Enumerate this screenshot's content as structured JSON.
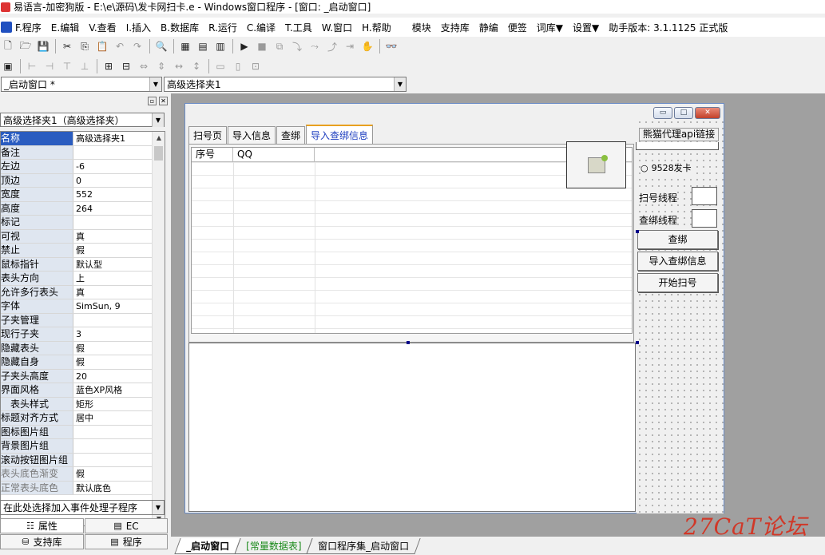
{
  "window": {
    "title": "易语言-加密狗版 - E:\\e\\源码\\发卡网扫卡.e - Windows窗口程序 - [窗口: _启动窗口]"
  },
  "menu": {
    "items": [
      "F.程序",
      "E.编辑",
      "V.查看",
      "I.插入",
      "B.数据库",
      "R.运行",
      "C.编译",
      "T.工具",
      "W.窗口",
      "H.帮助"
    ],
    "extra": [
      "模块",
      "支持库",
      "静编",
      "便签",
      "词库▼",
      "设置▼",
      "助手版本: 3.1.1125 正式版"
    ]
  },
  "combos": {
    "window_select": "_启动窗口 *",
    "control_select": "高级选择夹1"
  },
  "props": {
    "object_select": "高级选择夹1（高级选择夹）",
    "rows": [
      {
        "name": "名称",
        "value": "高级选择夹1"
      },
      {
        "name": "备注",
        "value": ""
      },
      {
        "name": "左边",
        "value": "-6"
      },
      {
        "name": "顶边",
        "value": "0"
      },
      {
        "name": "宽度",
        "value": "552"
      },
      {
        "name": "高度",
        "value": "264"
      },
      {
        "name": "标记",
        "value": ""
      },
      {
        "name": "可视",
        "value": "真"
      },
      {
        "name": "禁止",
        "value": "假"
      },
      {
        "name": "鼠标指针",
        "value": "默认型"
      },
      {
        "name": "表头方向",
        "value": "上"
      },
      {
        "name": "允许多行表头",
        "value": "真"
      },
      {
        "name": "字体",
        "value": "SimSun, 9"
      },
      {
        "name": "子夹管理",
        "value": ""
      },
      {
        "name": "现行子夹",
        "value": "3"
      },
      {
        "name": "隐藏表头",
        "value": "假"
      },
      {
        "name": "隐藏自身",
        "value": "假"
      },
      {
        "name": "子夹头高度",
        "value": "20"
      },
      {
        "name": "界面风格",
        "value": "蓝色XP风格"
      },
      {
        "name": "　表头样式",
        "value": "矩形"
      },
      {
        "name": "标题对齐方式",
        "value": "居中"
      },
      {
        "name": "图标图片组",
        "value": ""
      },
      {
        "name": "背景图片组",
        "value": ""
      },
      {
        "name": "滚动按钮图片组",
        "value": ""
      },
      {
        "name": "表头底色渐变",
        "value": "假"
      },
      {
        "name": "正常表头底色",
        "value": "默认底色"
      }
    ],
    "event_select": "在此处选择加入事件处理子程序",
    "tabs": [
      "属性",
      "EC",
      "支持库",
      "程序"
    ]
  },
  "form": {
    "tabs": [
      "扫号页",
      "导入信息",
      "查绑",
      "导入查绑信息"
    ],
    "list_columns": [
      "序号",
      "QQ"
    ],
    "label_panda": "熊猫代理api链接",
    "radio_9528": "9528发卡",
    "label_scan_threads": "扫号线程",
    "label_bind_threads": "查绑线程",
    "btn_check": "查绑",
    "btn_import": "导入查绑信息",
    "btn_start": "开始扫号"
  },
  "bottom_tabs": [
    "_启动窗口",
    "[常量数据表]",
    "窗口程序集_启动窗口"
  ],
  "watermark": "27CaT论坛"
}
